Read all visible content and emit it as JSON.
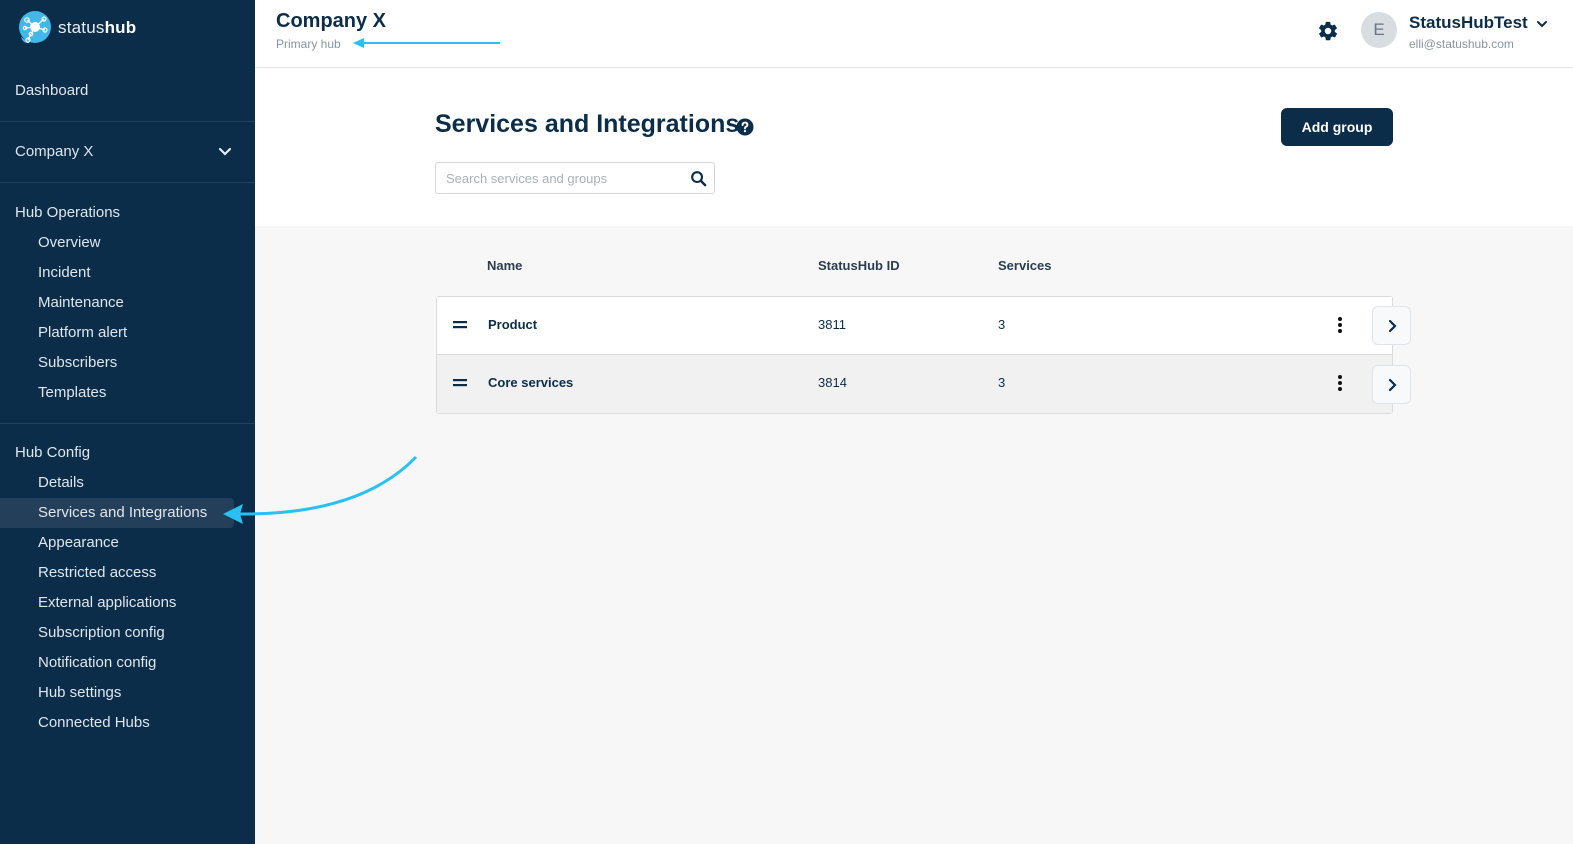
{
  "brand": {
    "name_light": "status",
    "name_bold": "hub",
    "icon": "statushub-logo-icon"
  },
  "sidebar": {
    "dashboard": "Dashboard",
    "hub_selector": {
      "label": "Company X",
      "icon": "chevron-down-icon"
    },
    "sections": [
      {
        "title": "Hub Operations",
        "items": [
          {
            "label": "Overview"
          },
          {
            "label": "Incident"
          },
          {
            "label": "Maintenance"
          },
          {
            "label": "Platform alert"
          },
          {
            "label": "Subscribers"
          },
          {
            "label": "Templates"
          }
        ]
      },
      {
        "title": "Hub Config",
        "items": [
          {
            "label": "Details"
          },
          {
            "label": "Services and Integrations",
            "active": true
          },
          {
            "label": "Appearance"
          },
          {
            "label": "Restricted access"
          },
          {
            "label": "External applications"
          },
          {
            "label": "Subscription config"
          },
          {
            "label": "Notification config"
          },
          {
            "label": "Hub settings"
          },
          {
            "label": "Connected Hubs"
          }
        ]
      }
    ]
  },
  "topbar": {
    "hub_name": "Company X",
    "hub_subtitle": "Primary hub",
    "settings_icon": "gear-icon",
    "user": {
      "avatar_initial": "E",
      "name": "StatusHubTest",
      "email": "elli@statushub.com"
    }
  },
  "page": {
    "title": "Services and Integrations",
    "help_icon": "question-circle-icon",
    "search": {
      "placeholder": "Search services and groups",
      "value": ""
    },
    "add_button": "Add group"
  },
  "table": {
    "columns": [
      "Name",
      "StatusHub ID",
      "Services"
    ],
    "rows": [
      {
        "name": "Product",
        "id": "3811",
        "services": "3"
      },
      {
        "name": "Core services",
        "id": "3814",
        "services": "3"
      }
    ]
  },
  "annotations": {
    "arrow_color": "#29c1f1"
  },
  "colors": {
    "sidebar_bg": "#0b2d4a",
    "primary": "#0b2d4a",
    "accent": "#29c1f1"
  }
}
